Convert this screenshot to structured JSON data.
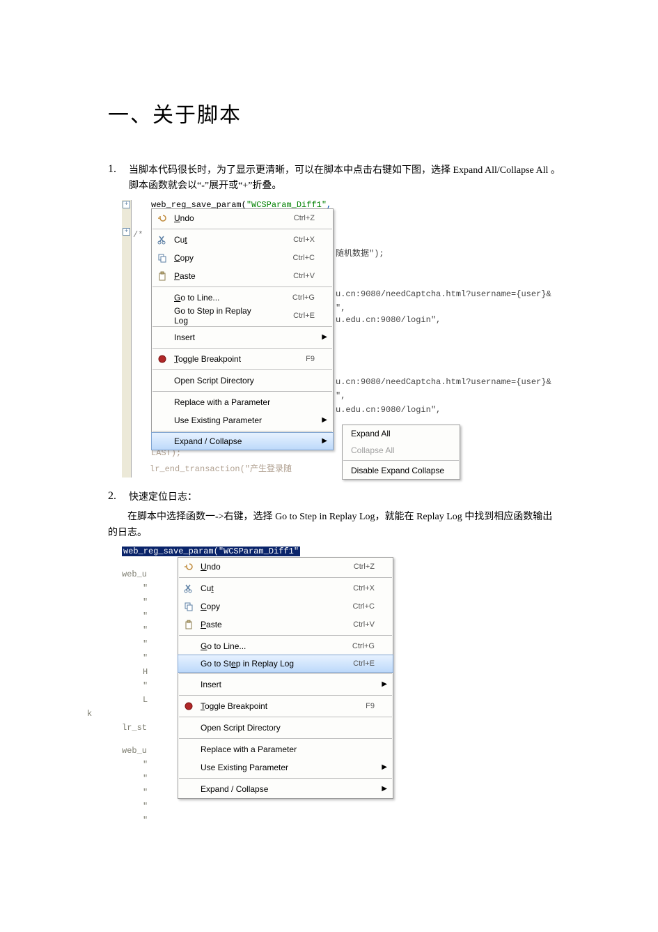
{
  "title": "一、关于脚本",
  "item1": {
    "num": "1.",
    "text_a": "当脚本代码很长时，为了显示更清晰，可以在脚本中点击右键如下图，选择",
    "text_b": "Expand All/Collapse All",
    "text_c": "。脚本函数就会以“-”展开或“+”折叠。"
  },
  "item2": {
    "num": "2.",
    "line1": "快速定位日志：",
    "line2a": "在脚本中选择函数一->右键，选择 ",
    "line2b": "Go to Step in Replay Log",
    "line2c": "，就能在 ",
    "line2d": "Replay Log",
    "line2e": " 中找到相应函数输出的日志。"
  },
  "code1": {
    "first_line_pre": "web_reg_save_param(",
    "first_line_str": "\"WCSParam_Diff1\"",
    "comma": ",",
    "comment_marker": "/*",
    "frag1": "随机数据\");",
    "frag2": "u.cn:9080/needCaptcha.html?username={user}&",
    "frag3": "\",",
    "frag4": "u.edu.cn:9080/login\",",
    "frag5": "u.cn:9080/needCaptcha.html?username={user}&",
    "frag6": "\",",
    "frag7": "u.edu.cn:9080/login\",",
    "frag8": "LAST);",
    "frag9": "lr_end_transaction(\"产生登录随"
  },
  "menu1": {
    "undo": {
      "label": "Undo",
      "shortcut": "Ctrl+Z"
    },
    "cut": {
      "label": "Cut",
      "shortcut": "Ctrl+X"
    },
    "copy": {
      "label": "Copy",
      "shortcut": "Ctrl+C"
    },
    "paste": {
      "label": "Paste",
      "shortcut": "Ctrl+V"
    },
    "goto_line": {
      "label": "Go to Line...",
      "shortcut": "Ctrl+G"
    },
    "goto_step": {
      "label": "Go to Step in Replay Log",
      "shortcut": "Ctrl+E"
    },
    "insert": {
      "label": "Insert"
    },
    "toggle_bp": {
      "label": "Toggle Breakpoint",
      "shortcut": "F9"
    },
    "open_dir": {
      "label": "Open Script Directory"
    },
    "replace_param": {
      "label": "Replace with a Parameter"
    },
    "use_param": {
      "label": "Use Existing Parameter"
    },
    "expand": {
      "label": "Expand / Collapse"
    }
  },
  "submenu1": {
    "expand_all": "Expand All",
    "collapse_all": "Collapse All",
    "disable": "Disable Expand Collapse"
  },
  "code2": {
    "sel": "web_reg_save_param(\"WCSParam_Diff1\"",
    "web_u": "web_u",
    "kme": "k",
    "lr_st": "lr_st",
    "web_u2": "web_u",
    "h": "H",
    "l": "L"
  },
  "menu2": {
    "undo": {
      "label": "Undo",
      "shortcut": "Ctrl+Z"
    },
    "cut": {
      "label": "Cut",
      "shortcut": "Ctrl+X"
    },
    "copy": {
      "label": "Copy",
      "shortcut": "Ctrl+C"
    },
    "paste": {
      "label": "Paste",
      "shortcut": "Ctrl+V"
    },
    "goto_line": {
      "label": "Go to Line...",
      "shortcut": "Ctrl+G"
    },
    "goto_step": {
      "label": "Go to Step in Replay Log",
      "shortcut": "Ctrl+E"
    },
    "insert": {
      "label": "Insert"
    },
    "toggle_bp": {
      "label": "Toggle Breakpoint",
      "shortcut": "F9"
    },
    "open_dir": {
      "label": "Open Script Directory"
    },
    "replace_param": {
      "label": "Replace with a Parameter"
    },
    "use_param": {
      "label": "Use Existing Parameter"
    },
    "expand": {
      "label": "Expand / Collapse"
    }
  }
}
